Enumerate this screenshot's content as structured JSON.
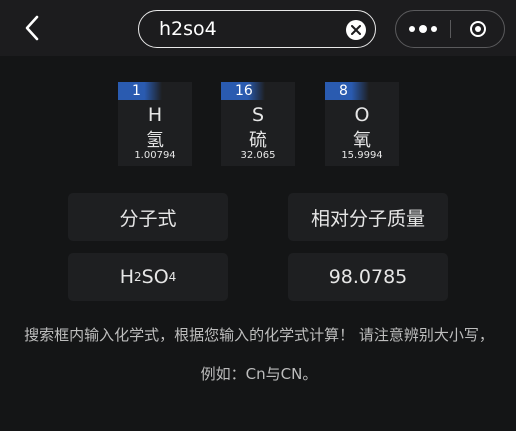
{
  "search": {
    "value": "h2so4"
  },
  "elements": [
    {
      "number": "1",
      "symbol": "H",
      "name": "氢",
      "mass": "1.00794"
    },
    {
      "number": "16",
      "symbol": "S",
      "name": "硫",
      "mass": "32.065"
    },
    {
      "number": "8",
      "symbol": "O",
      "name": "氧",
      "mass": "15.9994"
    }
  ],
  "table": {
    "formula_header": "分子式",
    "mass_header": "相对分子质量",
    "formula_parts": [
      "H",
      "2",
      "SO",
      "4"
    ],
    "mass_value": "98.0785"
  },
  "note": "搜索框内输入化学式，根据您输入的化学式计算！ 请注意辨别大小写，例如：Cn与CN。",
  "colors": {
    "background": "#141516",
    "topbar": "#1c1c1e",
    "panel": "#1e1f21",
    "element_number_bg": "#2a5bb0"
  },
  "icons": {
    "back": "chevron-left-icon",
    "clear": "clear-x-icon",
    "more": "more-dots-icon",
    "close": "target-circle-icon"
  }
}
